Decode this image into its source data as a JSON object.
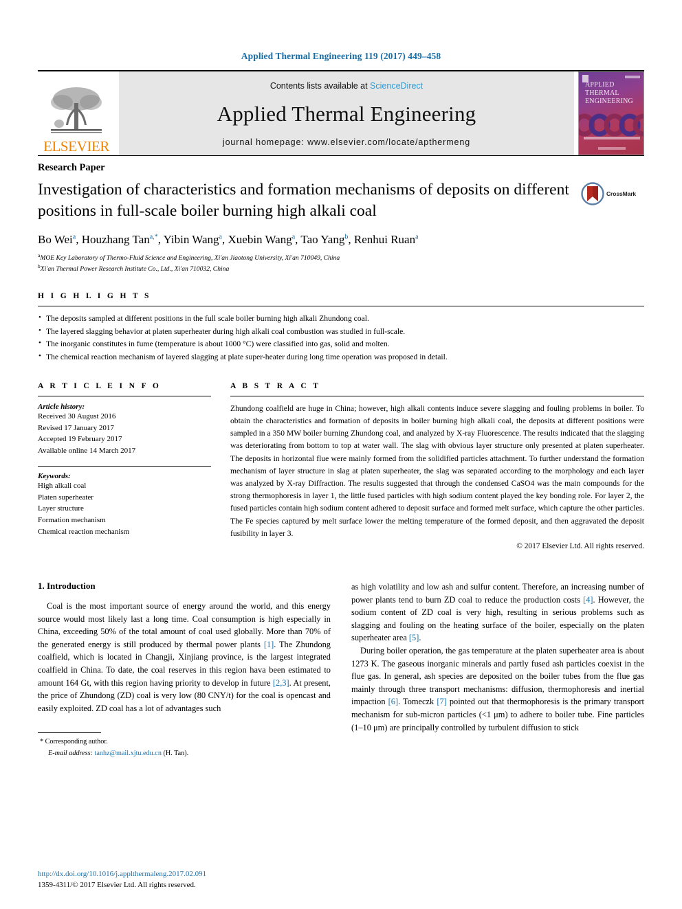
{
  "running_head": "Applied Thermal Engineering 119 (2017) 449–458",
  "masthead": {
    "publisher_name": "ELSEVIER",
    "contents_prefix": "Contents lists available at ",
    "sciencedirect_label": "ScienceDirect",
    "journal_title": "Applied Thermal Engineering",
    "homepage_label": "journal homepage: www.elsevier.com/locate/apthermeng",
    "cover_title_lines": [
      "APPLIED",
      "THERMAL",
      "ENGINEERING"
    ],
    "accent_link_color": "#2e9bd6",
    "elsevier_orange": "#ef8200"
  },
  "article": {
    "type": "Research Paper",
    "title": "Investigation of characteristics and formation mechanisms of deposits on different positions in full-scale boiler burning high alkali coal",
    "crossmark_label": "CrossMark",
    "authors": [
      {
        "name": "Bo Wei",
        "marks": "a"
      },
      {
        "name": "Houzhang Tan",
        "marks": "a,*"
      },
      {
        "name": "Yibin Wang",
        "marks": "a"
      },
      {
        "name": "Xuebin Wang",
        "marks": "a"
      },
      {
        "name": "Tao Yang",
        "marks": "b"
      },
      {
        "name": "Renhui Ruan",
        "marks": "a"
      }
    ],
    "affiliations": [
      {
        "mark": "a",
        "text": "MOE Key Laboratory of Thermo-Fluid Science and Engineering, Xi'an Jiaotong University, Xi'an 710049, China"
      },
      {
        "mark": "b",
        "text": "Xi'an Thermal Power Research Institute Co., Ltd., Xi'an 710032, China"
      }
    ]
  },
  "highlights": {
    "heading": "H I G H L I G H T S",
    "items": [
      "The deposits sampled at different positions in the full scale boiler burning high alkali Zhundong coal.",
      "The layered slagging behavior at platen superheater during high alkali coal combustion was studied in full-scale.",
      "The inorganic constitutes in fume (temperature is about 1000 °C) were classified into gas, solid and molten.",
      "The chemical reaction mechanism of layered slagging at plate super-heater during long time operation was proposed in detail."
    ]
  },
  "article_info": {
    "heading": "A R T I C L E   I N F O",
    "history_label": "Article history:",
    "history": [
      "Received 30 August 2016",
      "Revised 17 January 2017",
      "Accepted 19 February 2017",
      "Available online 14 March 2017"
    ],
    "keywords_label": "Keywords:",
    "keywords": [
      "High alkali coal",
      "Platen superheater",
      "Layer structure",
      "Formation mechanism",
      "Chemical reaction mechanism"
    ]
  },
  "abstract": {
    "heading": "A B S T R A C T",
    "text": "Zhundong coalfield are huge in China; however, high alkali contents induce severe slagging and fouling problems in boiler. To obtain the characteristics and formation of deposits in boiler burning high alkali coal, the deposits at different positions were sampled in a 350 MW boiler burning Zhundong coal, and analyzed by X-ray Fluorescence. The results indicated that the slagging was deteriorating from bottom to top at water wall. The slag with obvious layer structure only presented at platen superheater. The deposits in horizontal flue were mainly formed from the solidified particles attachment. To further understand the formation mechanism of layer structure in slag at platen superheater, the slag was separated according to the morphology and each layer was analyzed by X-ray Diffraction. The results suggested that through the condensed CaSO4 was the main compounds for the strong thermophoresis in layer 1, the little fused particles with high sodium content played the key bonding role. For layer 2, the fused particles contain high sodium content adhered to deposit surface and formed melt surface, which capture the other particles. The Fe species captured by melt surface lower the melting temperature of the formed deposit, and then aggravated the deposit fusibility in layer 3.",
    "copyright": "© 2017 Elsevier Ltd. All rights reserved."
  },
  "introduction": {
    "heading": "1. Introduction",
    "left_paragraph_part1": "Coal is the most important source of energy around the world, and this energy source would most likely last a long time. Coal consumption is high especially in China, exceeding 50% of the total amount of coal used globally. More than 70% of the generated energy is still produced by thermal power plants ",
    "ref1": "[1]",
    "left_paragraph_part2": ". The Zhundong coalfield, which is located in Changji, Xinjiang province, is the largest integrated coalfield in China. To date, the coal reserves in this region hava been estimated to amount 164 Gt, with this region having priority to develop in future ",
    "ref23": "[2,3]",
    "left_paragraph_part3": ". At present, the price of Zhundong (ZD) coal is very low (80 CNY/t) for the coal is opencast and easily exploited. ZD coal has a lot of advantages such",
    "right_paragraph1_part1": "as high volatility and low ash and sulfur content. Therefore, an increasing number of power plants tend to burn ZD coal to reduce the production costs ",
    "ref4": "[4]",
    "right_paragraph1_part2": ". However, the sodium content of ZD coal is very high, resulting in serious problems such as slagging and fouling on the heating surface of the boiler, especially on the platen superheater area ",
    "ref5": "[5]",
    "right_paragraph1_part3": ".",
    "right_paragraph2_part1": "During boiler operation, the gas temperature at the platen superheater area is about 1273 K. The gaseous inorganic minerals and partly fused ash particles coexist in the flue gas. In general, ash species are deposited on the boiler tubes from the flue gas mainly through three transport mechanisms: diffusion, thermophoresis and inertial impaction ",
    "ref6": "[6]",
    "right_paragraph2_part2": ". Tomeczk ",
    "ref7": "[7]",
    "right_paragraph2_part3": " pointed out that thermophoresis is the primary transport mechanism for sub-micron particles (<1 μm) to adhere to boiler tube. Fine particles (1–10 μm) are principally controlled by turbulent diffusion to stick"
  },
  "footnote": {
    "corresponding_mark": "*",
    "corresponding_label": "Corresponding author.",
    "email_label": "E-mail address:",
    "email": "tanhz@mail.xjtu.edu.cn",
    "email_suffix": "(H. Tan)."
  },
  "page_footer": {
    "doi": "http://dx.doi.org/10.1016/j.applthermaleng.2017.02.091",
    "issn": "1359-4311/© 2017 Elsevier Ltd. All rights reserved."
  }
}
